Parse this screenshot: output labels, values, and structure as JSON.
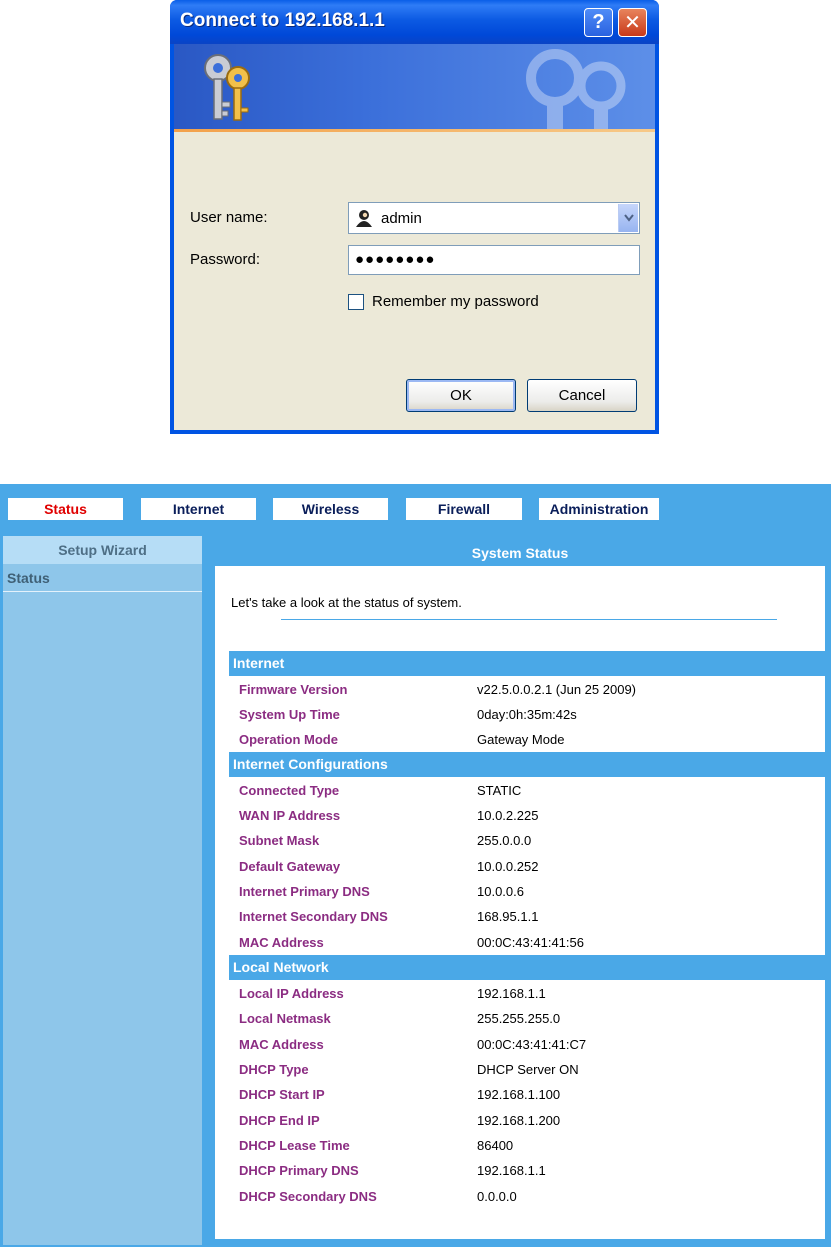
{
  "dialog": {
    "title": "Connect to 192.168.1.1",
    "username_label": "User name:",
    "username_value": "admin",
    "password_label": "Password:",
    "password_value": "●●●●●●●●",
    "remember_label": "Remember my password",
    "ok_label": "OK",
    "cancel_label": "Cancel"
  },
  "nav": {
    "tabs": [
      {
        "label": "Status"
      },
      {
        "label": "Internet"
      },
      {
        "label": "Wireless"
      },
      {
        "label": "Firewall"
      },
      {
        "label": "Administration"
      }
    ]
  },
  "sidebar": {
    "header": "Setup Wizard",
    "items": [
      {
        "label": "Status"
      }
    ]
  },
  "main": {
    "title": "System Status",
    "intro": "Let's take a look at the status of system."
  },
  "sections": {
    "internet": {
      "title": "Internet",
      "rows": [
        {
          "label": "Firmware Version",
          "value": "v22.5.0.0.2.1 (Jun 25 2009)"
        },
        {
          "label": "System Up Time",
          "value": "0day:0h:35m:42s"
        },
        {
          "label": "Operation Mode",
          "value": "Gateway Mode"
        }
      ]
    },
    "internet_config": {
      "title": "Internet Configurations",
      "rows": [
        {
          "label": "Connected Type",
          "value": "STATIC"
        },
        {
          "label": "WAN IP Address",
          "value": "10.0.2.225"
        },
        {
          "label": "Subnet Mask",
          "value": "255.0.0.0"
        },
        {
          "label": "Default Gateway",
          "value": "10.0.0.252"
        },
        {
          "label": "Internet Primary DNS",
          "value": "10.0.0.6"
        },
        {
          "label": "Internet Secondary DNS",
          "value": "168.95.1.1"
        },
        {
          "label": "MAC Address",
          "value": "00:0C:43:41:41:56"
        }
      ]
    },
    "local_network": {
      "title": "Local Network",
      "rows": [
        {
          "label": "Local IP Address",
          "value": "192.168.1.1"
        },
        {
          "label": "Local Netmask",
          "value": "255.255.255.0"
        },
        {
          "label": "MAC Address",
          "value": "00:0C:43:41:41:C7"
        },
        {
          "label": "DHCP Type",
          "value": "DHCP Server ON"
        },
        {
          "label": "DHCP Start IP",
          "value": "192.168.1.100"
        },
        {
          "label": "DHCP End IP",
          "value": "192.168.1.200"
        },
        {
          "label": "DHCP Lease Time",
          "value": "86400"
        },
        {
          "label": "DHCP Primary DNS",
          "value": "192.168.1.1"
        },
        {
          "label": "DHCP Secondary DNS",
          "value": "0.0.0.0"
        }
      ]
    }
  },
  "colors": {
    "accent_blue": "#4aa8e7",
    "label_purple": "#8b2c82",
    "active_tab_red": "#e00000"
  },
  "icons": {
    "dialog_banner": "keys-icon",
    "username": "user-icon"
  }
}
